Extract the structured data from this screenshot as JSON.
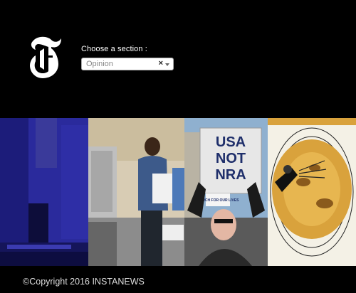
{
  "header": {
    "logo_icon": "nyt-t-logo-icon",
    "section_label": "Choose a section :",
    "select": {
      "value": "Opinion",
      "clear_glyph": "×"
    }
  },
  "articles": [
    {
      "icon": "stage-photo"
    },
    {
      "icon": "election-worker-photo"
    },
    {
      "icon": "protest-photo",
      "sign_text": [
        "USA",
        "NOT",
        "NRA"
      ],
      "small_sign": "MARCH FOR OUR LIVES"
    },
    {
      "icon": "illustration-photo"
    }
  ],
  "footer": {
    "copyright": "©Copyright 2016 INSTANEWS"
  },
  "colors": {
    "background": "#000000",
    "text": "#ffffff",
    "select_bg": "#ffffff"
  }
}
